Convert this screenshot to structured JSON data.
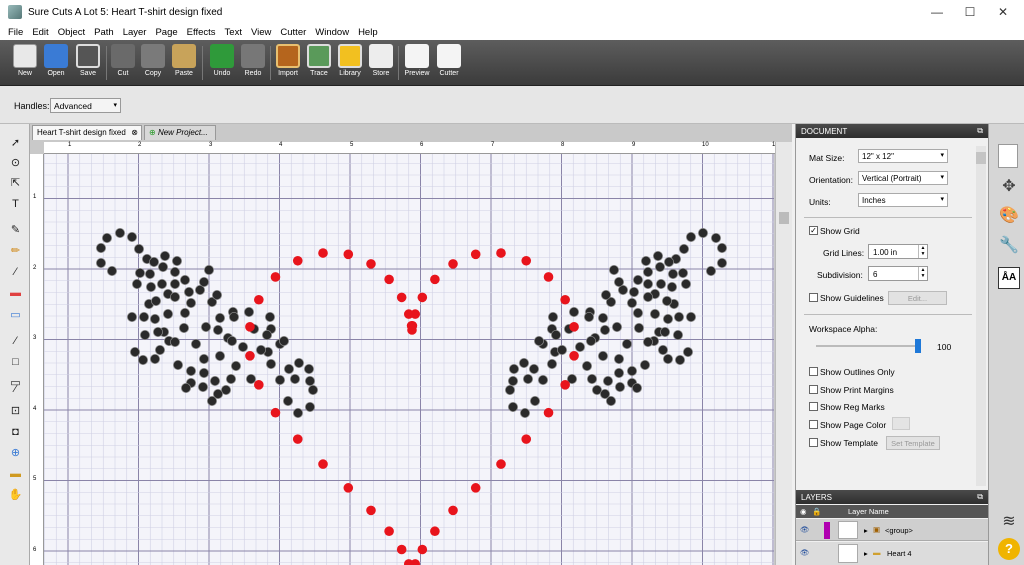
{
  "window": {
    "title": "Sure Cuts A Lot 5: Heart T-shirt design fixed",
    "controls": [
      "—",
      "☐",
      "✕"
    ]
  },
  "menu": [
    "File",
    "Edit",
    "Object",
    "Path",
    "Layer",
    "Page",
    "Effects",
    "Text",
    "View",
    "Cutter",
    "Window",
    "Help"
  ],
  "toolbar": {
    "new": "New",
    "open": "Open",
    "save": "Save",
    "cut": "Cut",
    "copy": "Copy",
    "paste": "Paste",
    "undo": "Undo",
    "redo": "Redo",
    "import": "Import",
    "trace": "Trace",
    "library": "Library",
    "store": "Store",
    "preview": "Preview",
    "cutter": "Cutter"
  },
  "handles": {
    "label": "Handles:",
    "value": "Advanced"
  },
  "tabs": {
    "active": "Heart T-shirt design fixed",
    "new_project": "New Project..."
  },
  "rulers": {
    "top": [
      "1",
      "2",
      "3",
      "4",
      "5",
      "6",
      "7",
      "8",
      "9",
      "10",
      "1"
    ],
    "left": [
      "1",
      "2",
      "3",
      "4",
      "5",
      "6"
    ]
  },
  "document_panel": {
    "header": "DOCUMENT",
    "mat_size_label": "Mat Size:",
    "mat_size": "12\" x 12\"",
    "orientation_label": "Orientation:",
    "orientation": "Vertical (Portrait)",
    "units_label": "Units:",
    "units": "Inches",
    "show_grid": "Show Grid",
    "grid_lines_label": "Grid Lines:",
    "grid_lines": "1.00 in",
    "subdivision_label": "Subdivision:",
    "subdivision": "6",
    "show_guidelines": "Show Guidelines",
    "edit_button": "Edit...",
    "workspace_alpha_label": "Workspace Alpha:",
    "workspace_alpha": "100",
    "show_outlines_only": "Show Outlines Only",
    "show_print_margins": "Show Print Margins",
    "show_reg_marks": "Show Reg Marks",
    "show_page_color": "Show Page Color",
    "show_template": "Show Template",
    "set_template": "Set Template"
  },
  "layers_panel": {
    "header": "LAYERS",
    "column": "Layer Name",
    "rows": [
      {
        "name": "<group>",
        "color": "#b000b0"
      },
      {
        "name": "Heart 4",
        "color": "#ffffff"
      }
    ]
  },
  "colors": {
    "heart": "#e8141c",
    "rhinestone": "#2a2a2a",
    "accent": "#1e78d8"
  }
}
